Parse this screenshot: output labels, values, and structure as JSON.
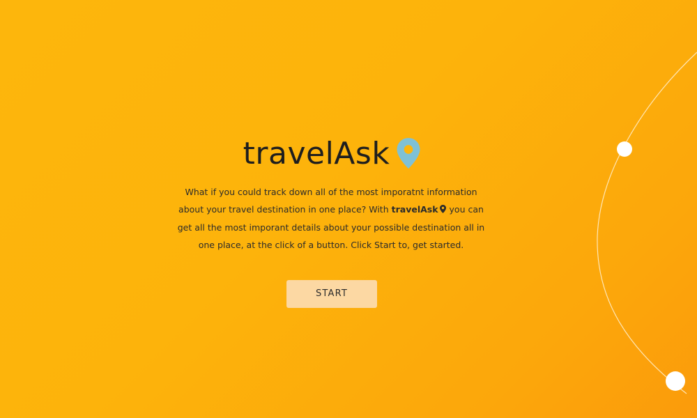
{
  "app": {
    "title": "travelAsk",
    "title_icon": "location-pin-icon"
  },
  "intro": {
    "text_before": "What if you could track down all of the most imporatnt information about your travel destination in one place? With",
    "brand": "travelAsk",
    "brand_icon": "location-pin-icon",
    "text_after": "you can get all the most imporant details about your possible destination all in one place, at the click of a button. Click Start to, get started."
  },
  "actions": {
    "start_label": "START"
  },
  "colors": {
    "background": "#fdb60c",
    "pin": "#7fc1d6",
    "button": "#fcd8a3",
    "text": "#2b2b2b"
  }
}
